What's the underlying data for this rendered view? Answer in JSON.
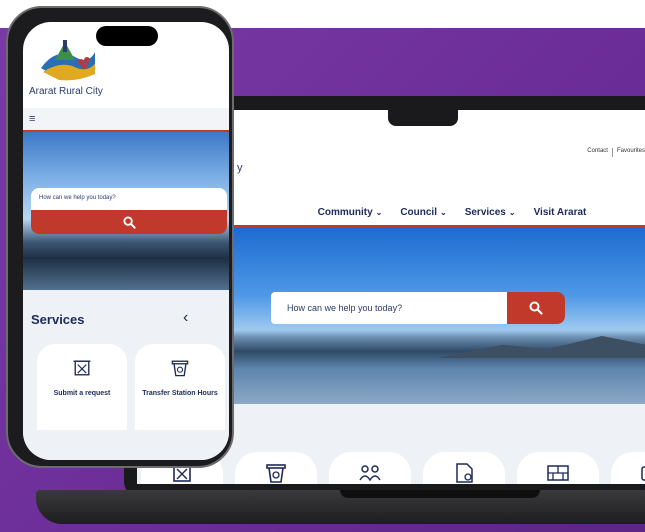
{
  "colors": {
    "accent": "#c0392b",
    "navy": "#1d2a5a",
    "purple": "#6a2c96"
  },
  "laptop": {
    "logo_fragment": "y",
    "top_links": [
      "Contact",
      "Favourites"
    ],
    "nav": [
      {
        "label": "Community",
        "has_dropdown": true
      },
      {
        "label": "Council",
        "has_dropdown": true
      },
      {
        "label": "Services",
        "has_dropdown": true
      },
      {
        "label": "Visit Ararat",
        "has_dropdown": false
      }
    ],
    "search": {
      "placeholder": "How can we help you today?"
    },
    "service_card_icons": [
      "request-icon",
      "bin-icon",
      "people-icon",
      "document-icon",
      "wall-icon",
      "card-icon"
    ]
  },
  "phone": {
    "site_name": "Ararat Rural City",
    "menu_icon": "hamburger-icon",
    "search": {
      "placeholder": "How can we help you today?"
    },
    "services": {
      "title": "Services",
      "cards": [
        {
          "label": "Submit a request",
          "icon": "request-icon"
        },
        {
          "label": "Transfer Station Hours",
          "icon": "bin-icon"
        }
      ]
    }
  }
}
